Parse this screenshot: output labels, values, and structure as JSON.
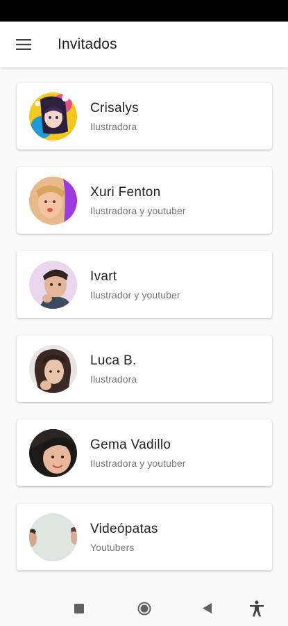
{
  "app": {
    "title": "Invitados"
  },
  "guests": [
    {
      "name": "Crisalys",
      "role": "Ilustradora"
    },
    {
      "name": "Xuri Fenton",
      "role": "Ilustradora y youtuber"
    },
    {
      "name": "Ivart",
      "role": "Ilustrador y youtuber"
    },
    {
      "name": "Luca B.",
      "role": "Ilustradora"
    },
    {
      "name": "Gema Vadillo",
      "role": "Ilustradora y youtuber"
    },
    {
      "name": "Videópatas",
      "role": "Youtubers"
    }
  ],
  "icons": {
    "menu": "hamburger-menu-icon",
    "nav_recents": "square-recents-icon",
    "nav_home": "circle-home-icon",
    "nav_back": "triangle-back-icon",
    "accessibility": "accessibility-icon"
  },
  "colors": {
    "status_bar": "#000000",
    "app_bar": "#ffffff",
    "background": "#fafafa",
    "title_text": "#212121",
    "secondary_text": "#757575"
  }
}
